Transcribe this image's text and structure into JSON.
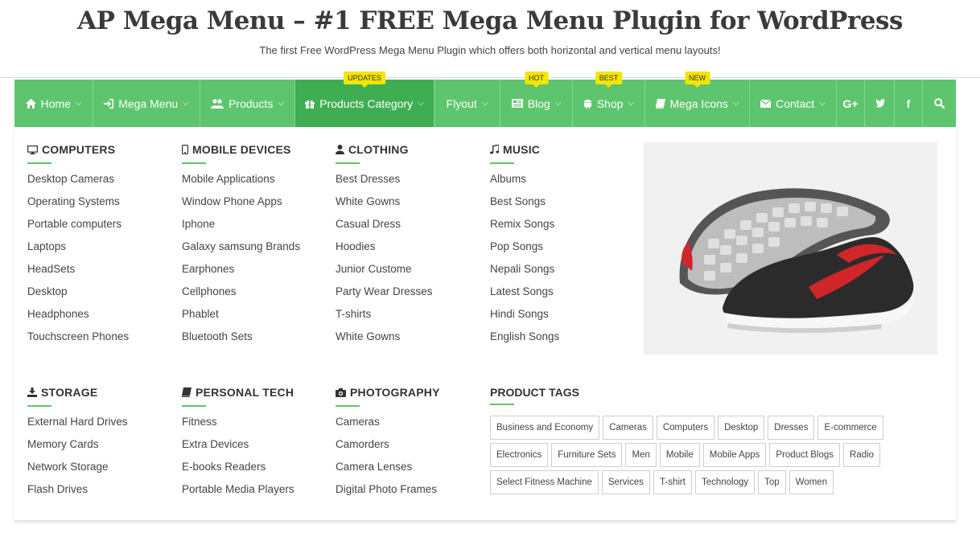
{
  "site": {
    "title": "AP Mega Menu – #1 FREE Mega Menu Plugin for WordPress",
    "tagline": "The first Free WordPress Mega Menu Plugin which offers both horizontal and vertical menu layouts!"
  },
  "colors": {
    "nav_bg": "#5ec56e",
    "nav_active": "#3fae52",
    "badge": "#f4e500",
    "accent_line": "#5ec56e"
  },
  "nav": {
    "home": "Home",
    "mega_menu": "Mega Menu",
    "products": "Products",
    "products_category": "Products Category",
    "flyout": "Flyout",
    "blog": "Blog",
    "shop": "Shop",
    "mega_icons": "Mega Icons",
    "contact": "Contact",
    "badges": {
      "updates": "UPDATES",
      "hot": "HOT",
      "best": "BEST",
      "new": "NEW"
    },
    "social": {
      "googleplus": "G+",
      "twitter": "twitter-icon",
      "facebook": "f",
      "search": "search-icon"
    }
  },
  "columns": {
    "computers": {
      "title": "COMPUTERS",
      "items": [
        "Desktop Cameras",
        "Operating Systems",
        "Portable computers",
        "Laptops",
        "HeadSets",
        "Desktop",
        "Headphones",
        "Touchscreen Phones"
      ]
    },
    "mobile": {
      "title": "MOBILE DEVICES",
      "items": [
        "Mobile Applications",
        "Window Phone Apps",
        "Iphone",
        "Galaxy samsung Brands",
        "Earphones",
        "Cellphones",
        "Phablet",
        "Bluetooth Sets"
      ]
    },
    "clothing": {
      "title": "CLOTHING",
      "items": [
        "Best Dresses",
        "White Gowns",
        "Casual Dress",
        "Hoodies",
        "Junior Custome",
        "Party Wear Dresses",
        "T-shirts",
        "White Gowns"
      ]
    },
    "music": {
      "title": "MUSIC",
      "items": [
        "Albums",
        "Best Songs",
        "Remix Songs",
        "Pop Songs",
        "Nepali Songs",
        "Latest Songs",
        "Hindi Songs",
        "English Songs"
      ]
    },
    "storage": {
      "title": "STORAGE",
      "items": [
        "External Hard Drives",
        "Memory Cards",
        "Network Storage",
        "Flash Drives"
      ]
    },
    "personal_tech": {
      "title": "PERSONAL TECH",
      "items": [
        "Fitness",
        "Extra Devices",
        "E-books Readers",
        "Portable Media Players"
      ]
    },
    "photography": {
      "title": "PHOTOGRAPHY",
      "items": [
        "Cameras",
        "Camorders",
        "Camera Lenses",
        "Digital Photo Frames"
      ]
    }
  },
  "tags": {
    "title": "PRODUCT TAGS",
    "items": [
      "Business and Economy",
      "Cameras",
      "Computers",
      "Desktop",
      "Dresses",
      "E-commerce",
      "Electronics",
      "Furniture Sets",
      "Men",
      "Mobile",
      "Mobile Apps",
      "Product Blogs",
      "Radio",
      "Select Fitness Machine",
      "Services",
      "T-shirt",
      "Technology",
      "Top",
      "Women"
    ]
  }
}
